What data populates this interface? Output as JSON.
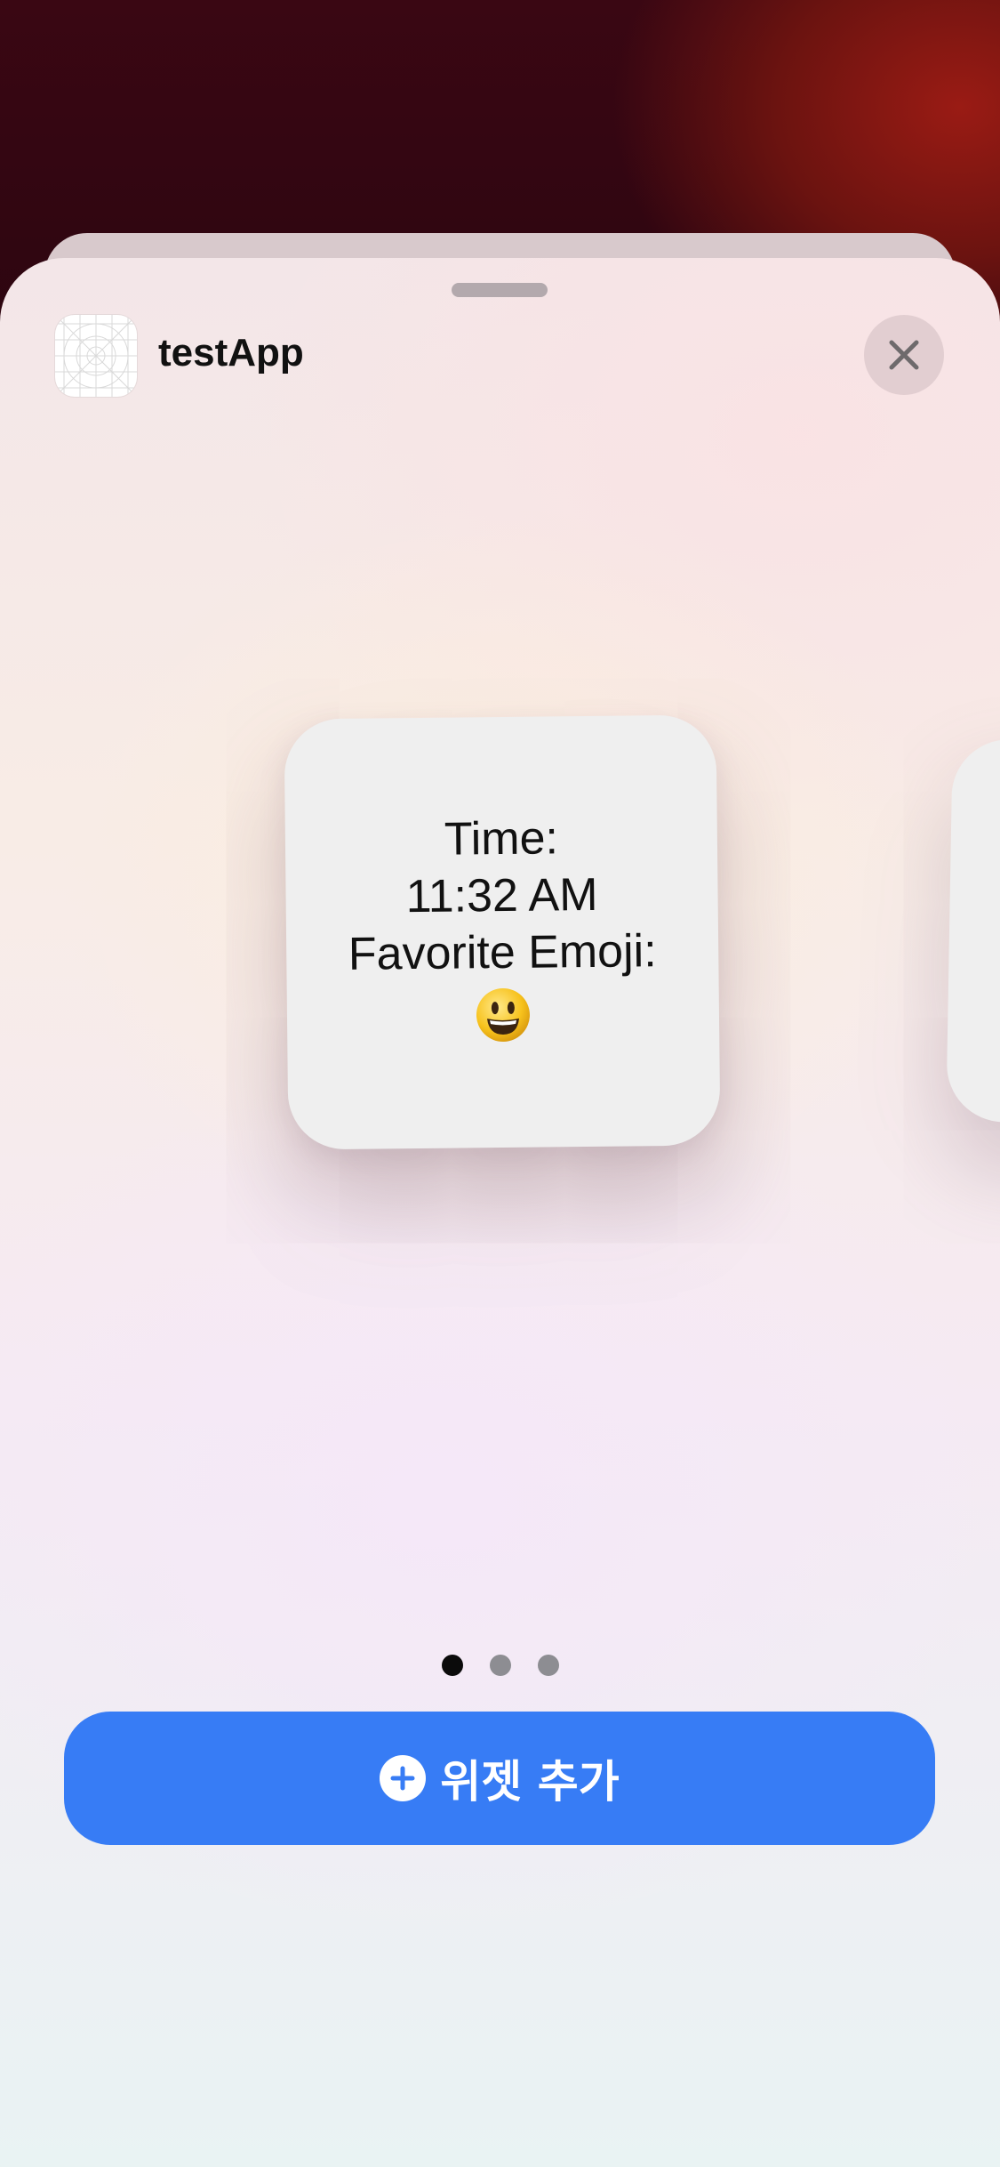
{
  "sheet": {
    "app_name": "testApp",
    "close_icon": "close-icon"
  },
  "widget": {
    "line1": "Time:",
    "line2": "11:32 AM",
    "line3": "Favorite Emoji:",
    "emoji": "😃"
  },
  "pager": {
    "pages": 3,
    "active_index": 0
  },
  "add_widget": {
    "label": "위젯 추가",
    "icon": "plus-circle-icon"
  },
  "colors": {
    "accent": "#377cf5",
    "wallpaper_red": "#9a1b14"
  }
}
